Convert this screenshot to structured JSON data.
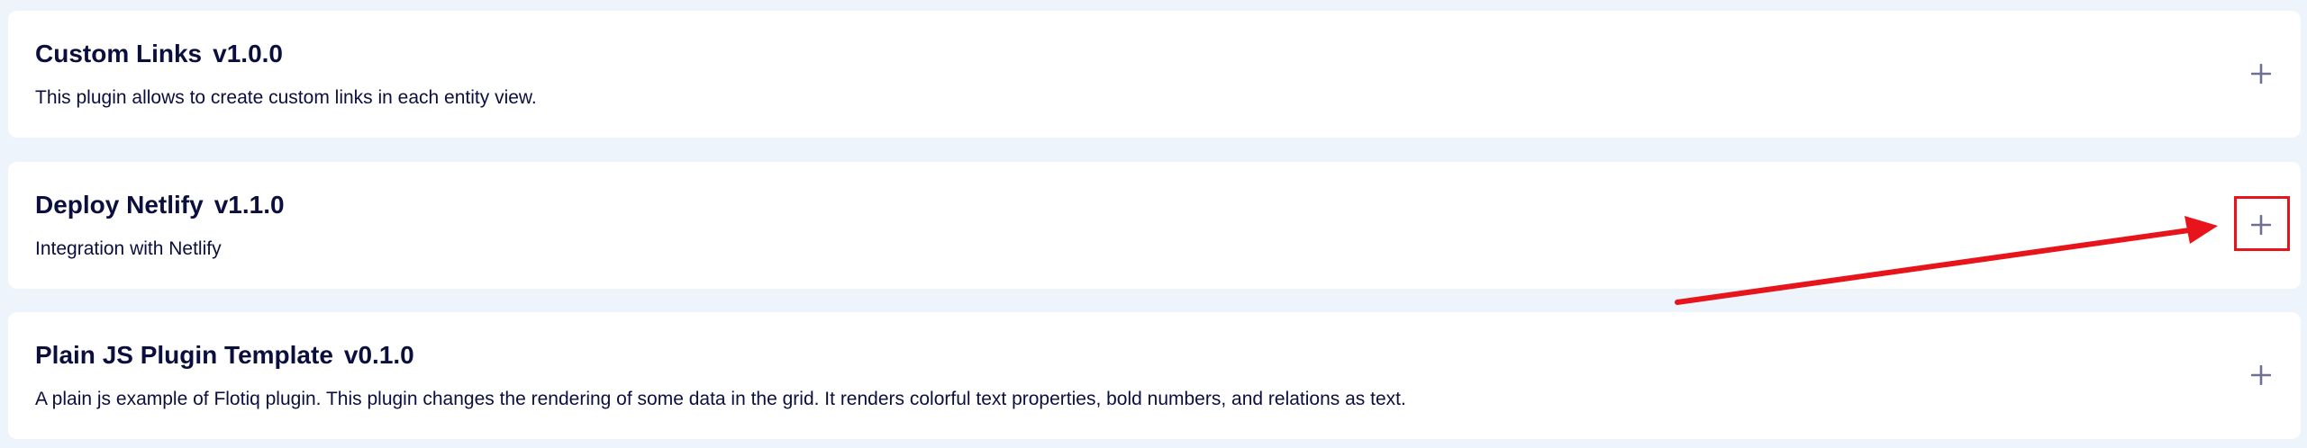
{
  "plugins": [
    {
      "name": "Custom Links",
      "version": "v1.0.0",
      "description": "This plugin allows to create custom links in each entity view.",
      "action_icon": "plus-icon"
    },
    {
      "name": "Deploy Netlify",
      "version": "v1.1.0",
      "description": "Integration with Netlify",
      "action_icon": "plus-icon"
    },
    {
      "name": "Plain JS Plugin Template",
      "version": "v0.1.0",
      "description": "A plain js example of Flotiq plugin. This plugin changes the rendering of some data in the grid. It renders colorful text properties, bold numbers, and relations as text.",
      "action_icon": "plus-icon"
    }
  ],
  "annotation": {
    "type": "arrow-with-box",
    "target": "Deploy Netlify expand button",
    "color": "#e8141b"
  },
  "colors": {
    "background": "#eef4fc",
    "card": "#ffffff",
    "text": "#0b0f3d",
    "icon": "#6e7191",
    "annotation": "#e8141b"
  }
}
